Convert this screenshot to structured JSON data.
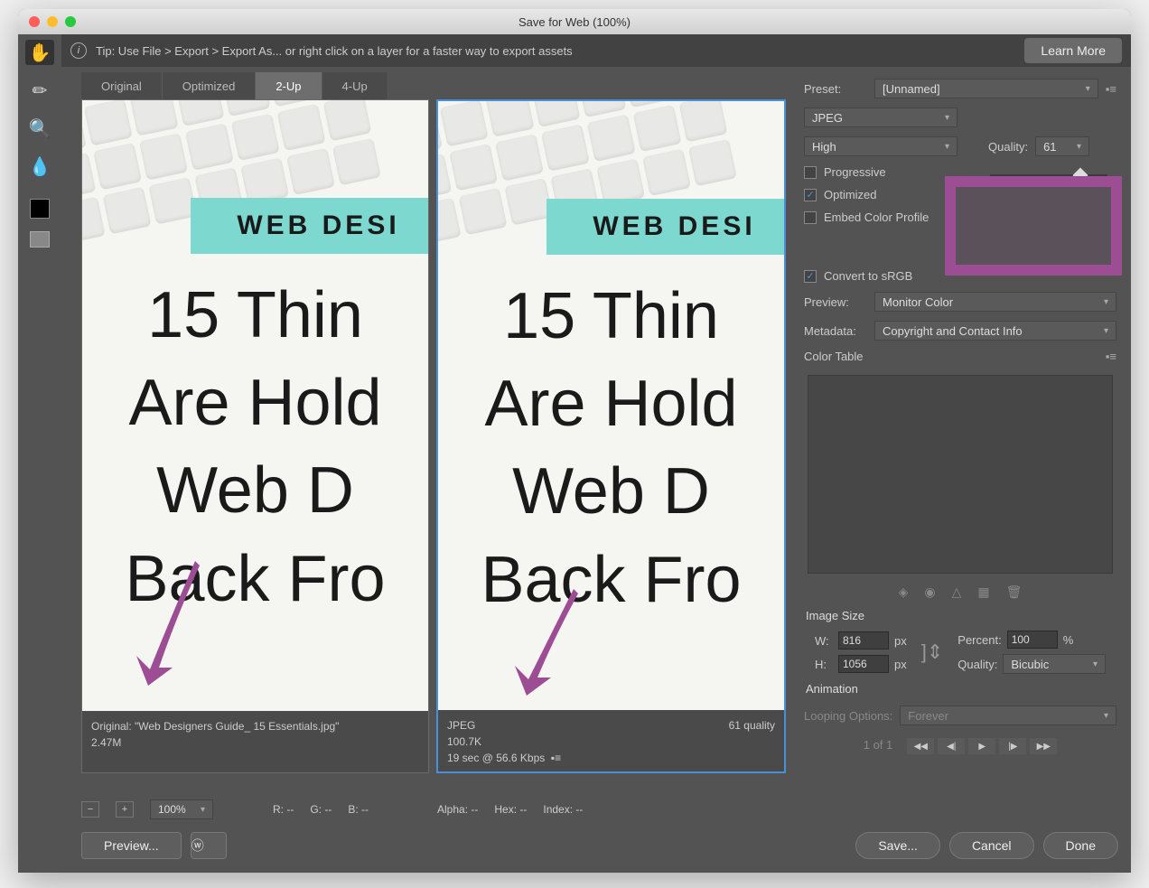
{
  "title": "Save for Web (100%)",
  "tip": "Tip: Use File > Export > Export As... or right click on a layer for a faster way to export assets",
  "learn_more": "Learn More",
  "tabs": [
    "Original",
    "Optimized",
    "2-Up",
    "4-Up"
  ],
  "active_tab": "2-Up",
  "preview_text": {
    "banner": "WEB DESI",
    "line1": "15 Thin",
    "line2": "Are Hold",
    "line3": "Web D",
    "line4": "Back Fro"
  },
  "pane_left": {
    "line1": "Original: \"Web Designers Guide_ 15 Essentials.jpg\"",
    "line2": "2.47M"
  },
  "pane_right": {
    "line1": "JPEG",
    "right1": "61 quality",
    "line2": "100.7K",
    "line3": "19 sec @ 56.6 Kbps"
  },
  "status": {
    "zoom": "100%",
    "r": "R: --",
    "g": "G: --",
    "b": "B: --",
    "alpha": "Alpha: --",
    "hex": "Hex: --",
    "index": "Index: --"
  },
  "bottom": {
    "preview": "Preview...",
    "save": "Save...",
    "cancel": "Cancel",
    "done": "Done"
  },
  "right": {
    "preset_label": "Preset:",
    "preset_value": "[Unnamed]",
    "format": "JPEG",
    "quality_preset": "High",
    "quality_label": "Quality:",
    "quality_value": "61",
    "progressive": "Progressive",
    "optimized": "Optimized",
    "embed": "Embed Color Profile",
    "convert": "Convert to sRGB",
    "preview_label": "Preview:",
    "preview_value": "Monitor Color",
    "metadata_label": "Metadata:",
    "metadata_value": "Copyright and Contact Info",
    "color_table": "Color Table",
    "image_size": "Image Size",
    "w": "816",
    "h": "1056",
    "px": "px",
    "percent_label": "Percent:",
    "percent": "100",
    "pct": "%",
    "q_label": "Quality:",
    "q_value": "Bicubic",
    "animation": "Animation",
    "loop_label": "Looping Options:",
    "loop_value": "Forever",
    "frame": "1 of 1"
  }
}
